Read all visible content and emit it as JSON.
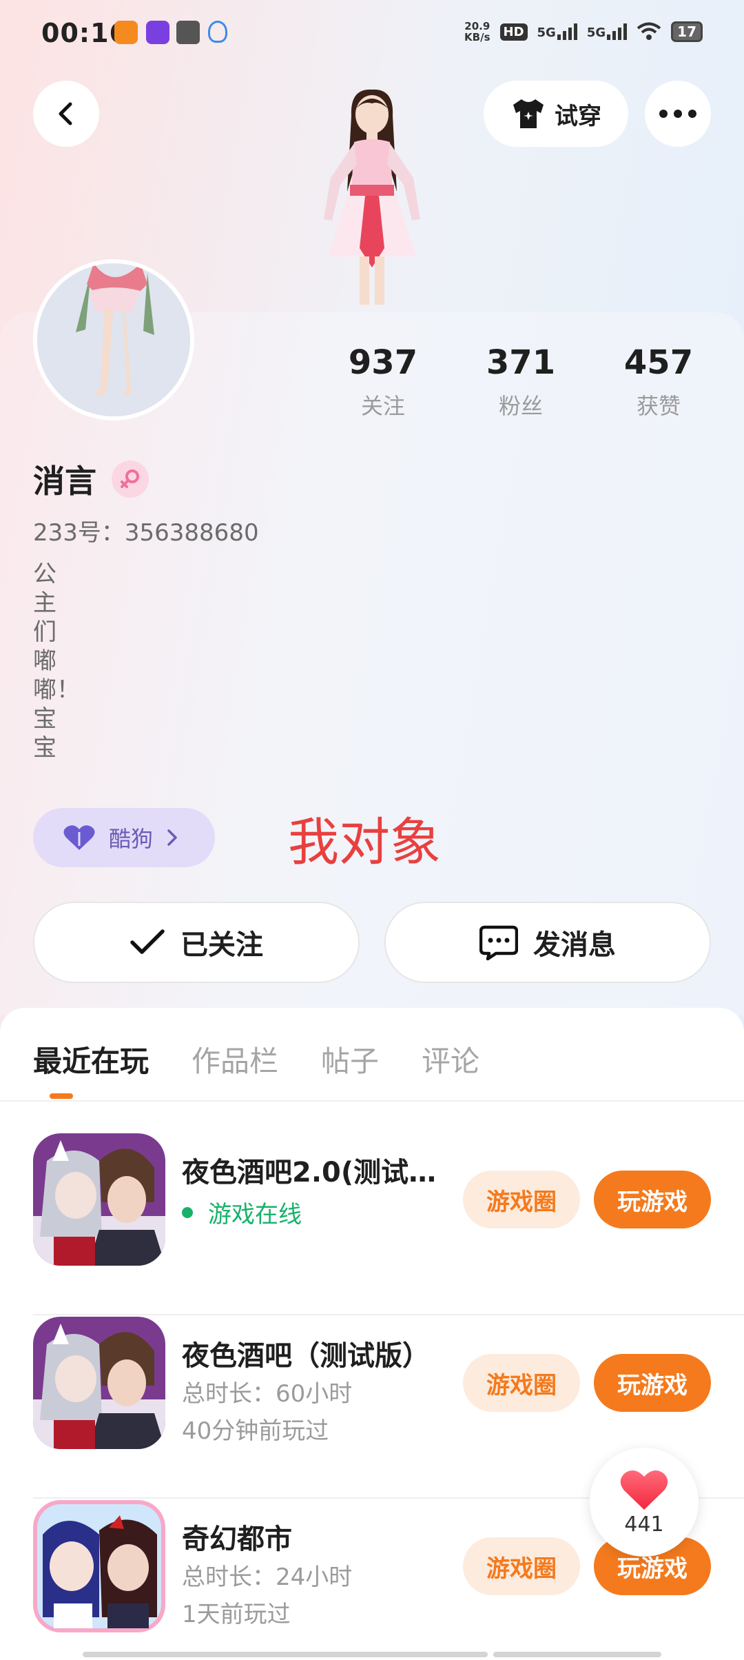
{
  "status_bar": {
    "time": "00:16",
    "net_speed_value": "20.9",
    "net_speed_unit": "KB/s",
    "hd_label": "HD",
    "sim1_label": "5G",
    "sim2_label": "5G",
    "battery": "17"
  },
  "header": {
    "try_on_label": "试穿"
  },
  "profile": {
    "name": "消言",
    "uid": "233号：356388680",
    "bio": "公主们嘟嘟！宝宝",
    "stats": [
      {
        "value": "937",
        "label": "关注"
      },
      {
        "value": "371",
        "label": "粉丝"
      },
      {
        "value": "457",
        "label": "获赞"
      }
    ],
    "badge_label": "酷狗",
    "overlay_note": "我对象",
    "follow_label": "已关注",
    "message_label": "发消息"
  },
  "tabs": [
    "最近在玩",
    "作品栏",
    "帖子",
    "评论"
  ],
  "games": [
    {
      "title": "夜色酒吧2.0(测试…",
      "status": "游戏在线",
      "circle_label": "游戏圈",
      "play_label": "玩游戏"
    },
    {
      "title": "夜色酒吧（测试版）",
      "duration": "总时长：60小时",
      "last_played": "40分钟前玩过",
      "circle_label": "游戏圈",
      "play_label": "玩游戏"
    },
    {
      "title": "奇幻都市",
      "duration": "总时长：24小时",
      "last_played": "1天前玩过",
      "circle_label": "游戏圈",
      "play_label": "玩游戏"
    }
  ],
  "like_count": "441",
  "colors": {
    "accent": "#f47a1d",
    "online": "#17b26a",
    "note": "#e8403f",
    "badge_bg": "#e3dcf8"
  }
}
